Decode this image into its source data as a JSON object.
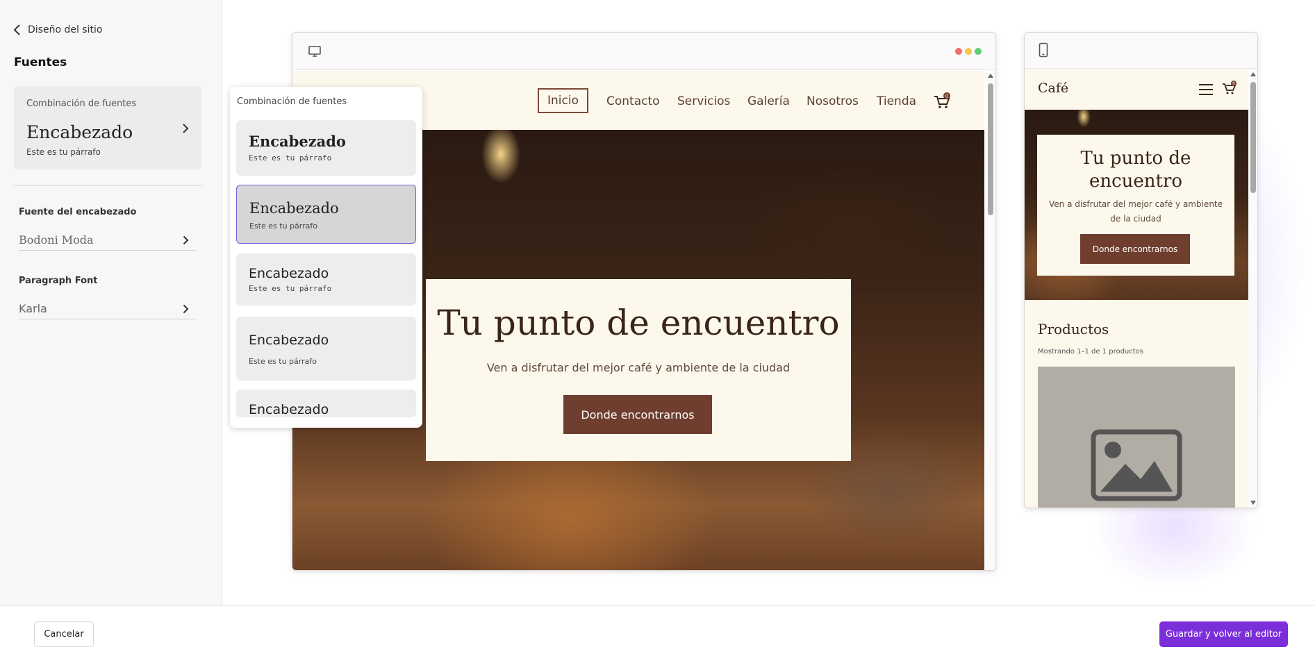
{
  "sidebar": {
    "back_label": "Diseño del sitio",
    "title": "Fuentes",
    "combo_card": {
      "label": "Combinación de fuentes",
      "heading_sample": "Encabezado",
      "paragraph_sample": "Este es tu párrafo"
    },
    "heading_font": {
      "label": "Fuente del encabezado",
      "value": "Bodoni Moda"
    },
    "paragraph_font": {
      "label": "Paragraph Font",
      "value": "Karla"
    }
  },
  "font_panel": {
    "title": "Combinación de fuentes",
    "options": [
      {
        "heading": "Encabezado",
        "paragraph": "Este es tu párrafo"
      },
      {
        "heading": "Encabezado",
        "paragraph": "Este es tu párrafo"
      },
      {
        "heading": "Encabezado",
        "paragraph": "Este es tu párrafo"
      },
      {
        "heading": "Encabezado",
        "paragraph": "Este es tu párrafo"
      },
      {
        "heading": "Encabezado",
        "paragraph": ""
      }
    ],
    "selected_index": 1
  },
  "desktop_preview": {
    "icon": "monitor-icon",
    "nav": [
      "Inicio",
      "Contacto",
      "Servicios",
      "Galería",
      "Nosotros",
      "Tienda"
    ],
    "active_nav": "Inicio",
    "cart_count": "0",
    "hero": {
      "title": "Tu punto de encuentro",
      "subtitle": "Ven a disfrutar del mejor café y ambiente de la ciudad",
      "button": "Donde encontrarnos"
    }
  },
  "mobile_preview": {
    "icon": "phone-icon",
    "logo": "Café",
    "cart_count": "0",
    "hero": {
      "title": "Tu punto de encuentro",
      "subtitle": "Ven a disfrutar del mejor café y ambiente de la ciudad",
      "button": "Donde encontrarnos"
    },
    "products_title": "Productos",
    "products_count": "Mostrando 1–1 de 1 productos"
  },
  "footer": {
    "cancel": "Cancelar",
    "save": "Guardar y volver al editor"
  },
  "colors": {
    "accent": "#7a2fd8",
    "brand_brown": "#6f3e2e",
    "cream": "#fdf8ec",
    "selected_border": "#7d5bd6"
  }
}
